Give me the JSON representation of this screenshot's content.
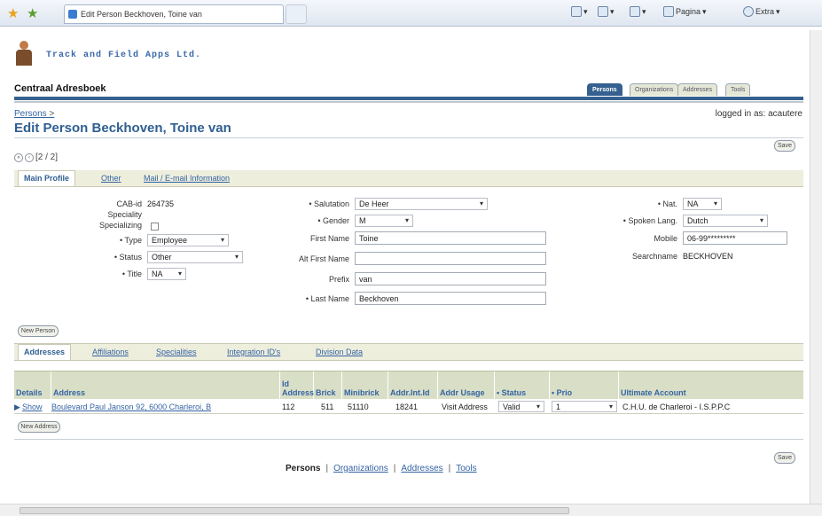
{
  "browser": {
    "tab_title": "Edit Person Beckhoven, Toine van",
    "pagina_label": "Pagina",
    "extra_label": "Extra"
  },
  "brand": {
    "name": "Track and Field Apps Ltd.",
    "app_title": "Centraal Adresboek"
  },
  "global_tabs": [
    "Persons",
    "Organizations",
    "Addresses",
    "Tools"
  ],
  "breadcrumb": {
    "link": "Persons",
    "sep": ">"
  },
  "logged_in": "logged in as: acautere",
  "page_title": "Edit Person Beckhoven, Toine van",
  "save_label": "Save",
  "nav_count": "[2 / 2]",
  "sub_tabs": [
    "Main Profile",
    "Other",
    "Mail / E-mail Information"
  ],
  "profile": {
    "cab_label": "CAB-id",
    "cab_value": "264735",
    "speciality_label": "Speciality",
    "specializing_label": "Specializing",
    "type_label": "• Type",
    "type_value": "Employee",
    "status_label": "• Status",
    "status_value": "Other",
    "title_label": "• Title",
    "title_value": "NA",
    "salutation_label": "• Salutation",
    "salutation_value": "De Heer",
    "gender_label": "• Gender",
    "gender_value": "M",
    "firstname_label": "First Name",
    "firstname_value": "Toine",
    "altfirst_label": "Alt First Name",
    "altfirst_value": "",
    "prefix_label": "Prefix",
    "prefix_value": "van",
    "lastname_label": "• Last Name",
    "lastname_value": "Beckhoven",
    "nat_label": "• Nat.",
    "nat_value": "NA",
    "spoken_label": "• Spoken Lang.",
    "spoken_value": "Dutch",
    "mobile_label": "Mobile",
    "mobile_value": "06-99*********",
    "searchname_label": "Searchname",
    "searchname_value": "BECKHOVEN"
  },
  "new_person_label": "New Person",
  "lower_tabs": [
    "Addresses",
    "Affiliations",
    "Specialities",
    "Integration ID's",
    "Division Data"
  ],
  "table": {
    "headers": [
      "Details",
      "Address",
      "Id Address",
      "Brick",
      "Minibrick",
      "Addr.Int.Id",
      "Addr Usage",
      "• Status",
      "• Prio",
      "Ultimate Account"
    ],
    "row": {
      "details": "Show",
      "address": "Boulevard Paul Janson 92, 6000 Charleroi, B",
      "id": "112",
      "brick": "511",
      "minibrick": "51110",
      "intid": "18241",
      "usage": "Visit Address",
      "status": "Valid",
      "prio": "1",
      "account": "C.H.U. de Charleroi - I.S.P.P.C"
    }
  },
  "new_address_label": "New Address",
  "footer": {
    "persons": "Persons",
    "organizations": "Organizations",
    "addresses": "Addresses",
    "tools": "Tools",
    "sep": "|"
  }
}
